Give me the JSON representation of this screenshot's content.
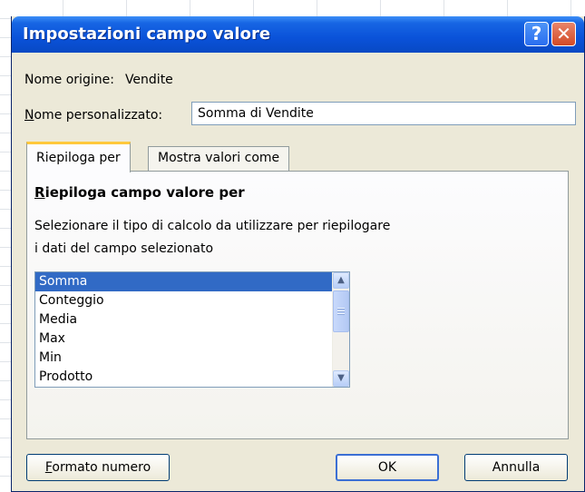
{
  "dialog": {
    "title": "Impostazioni campo valore",
    "help_glyph": "?",
    "close_glyph": "✕"
  },
  "source": {
    "label": "Nome origine:",
    "value": "Vendite"
  },
  "custom_name": {
    "label_accel": "N",
    "label_rest": "ome personalizzato:",
    "value": "Somma di Vendite"
  },
  "tabs": [
    {
      "label": "Riepiloga per",
      "active": true
    },
    {
      "label": "Mostra valori come",
      "active": false
    }
  ],
  "panel": {
    "title_accel": "R",
    "title_rest": "iepiloga campo valore per",
    "desc_line1": "Selezionare il tipo di calcolo da utilizzare per riepilogare",
    "desc_line2": "i dati del campo selezionato",
    "functions": [
      "Somma",
      "Conteggio",
      "Media",
      "Max",
      "Min",
      "Prodotto"
    ],
    "selected": "Somma"
  },
  "buttons": {
    "format_accel": "F",
    "format_rest": "ormato numero",
    "ok": "OK",
    "cancel": "Annulla"
  },
  "colors": {
    "title_bar": "#0a52d9",
    "selection": "#316ac5",
    "tab_highlight": "#ffc83c",
    "dialog_bg": "#ece9d8"
  }
}
